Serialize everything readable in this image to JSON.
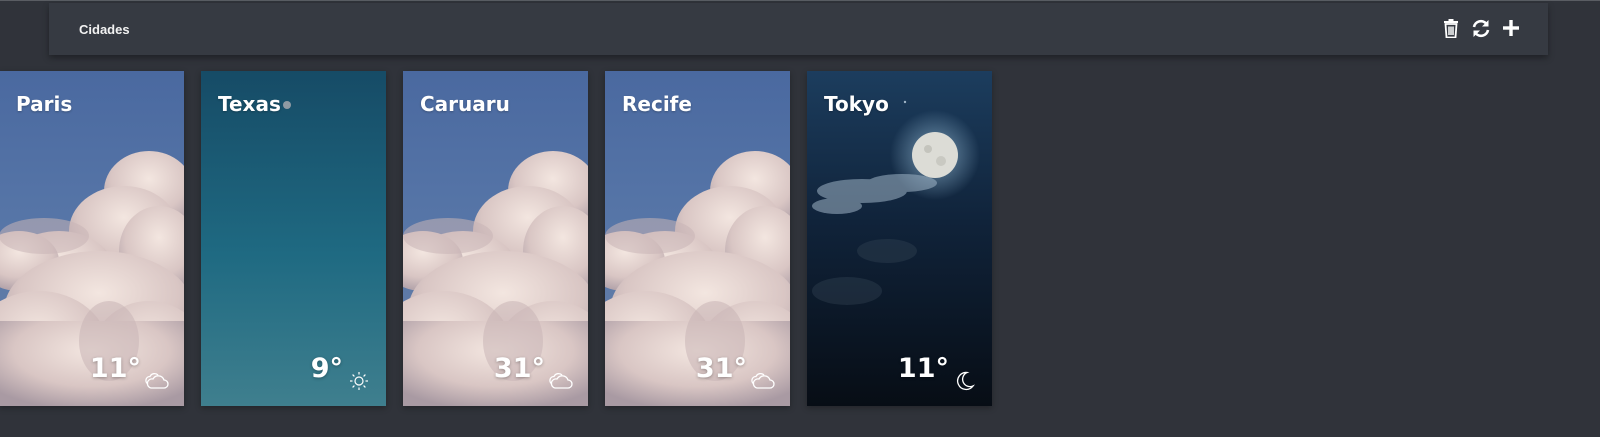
{
  "header": {
    "title": "Cidades",
    "actions": [
      {
        "icon": "trash-icon"
      },
      {
        "icon": "refresh-icon"
      },
      {
        "icon": "plus-icon"
      }
    ]
  },
  "cities": [
    {
      "name": "Paris",
      "temperature": "11°",
      "condition_icon": "cloud-icon",
      "background": "daytime clouds"
    },
    {
      "name": "Texas",
      "temperature": "9°",
      "condition_icon": "sun-icon",
      "background": "clear teal sky"
    },
    {
      "name": "Caruaru",
      "temperature": "31°",
      "condition_icon": "cloud-icon",
      "background": "daytime clouds"
    },
    {
      "name": "Recife",
      "temperature": "31°",
      "condition_icon": "cloud-icon",
      "background": "daytime clouds"
    },
    {
      "name": "Tokyo",
      "temperature": "11°",
      "condition_icon": "moon-icon",
      "background": "night moon"
    }
  ],
  "colors": {
    "page_bg": "#30333a",
    "topbar_bg": "#363a42",
    "sky_day": "#4f6f9e",
    "sky_teal": "#1d5a73",
    "sky_night": "#0c1520"
  }
}
